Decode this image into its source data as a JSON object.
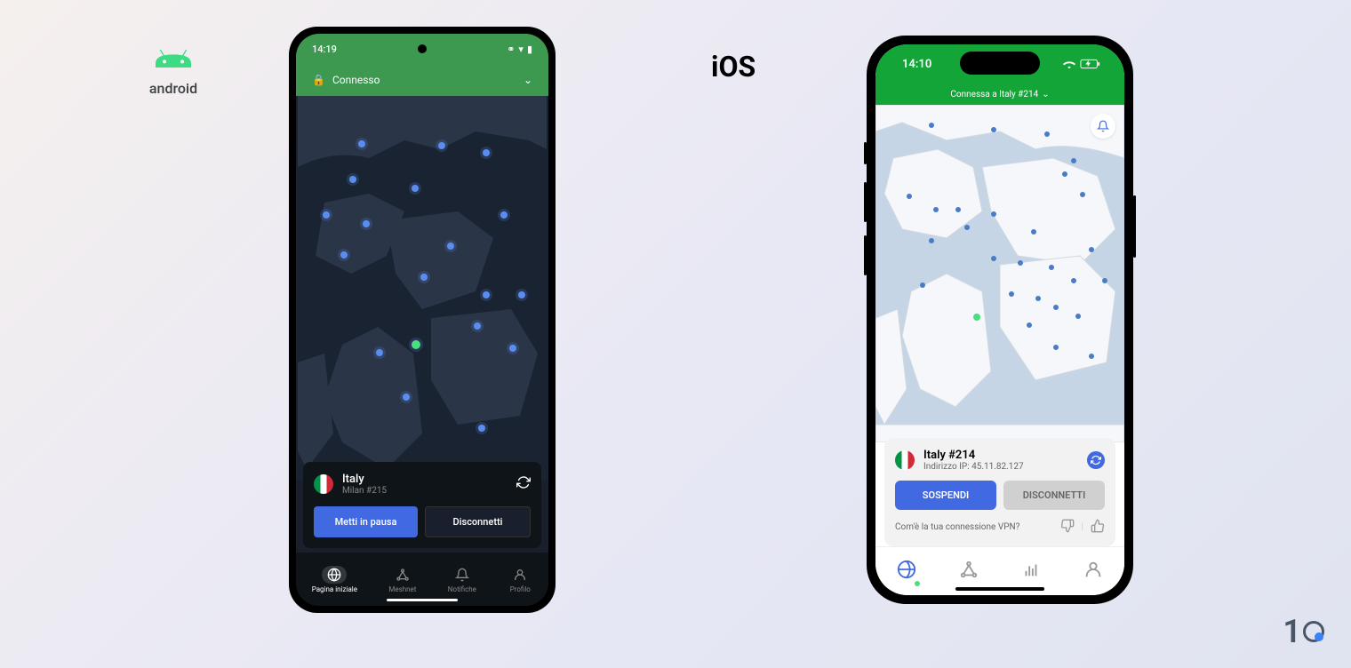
{
  "platforms": {
    "android_label": "android",
    "ios_label": "iOS"
  },
  "android": {
    "status": {
      "time": "14:19"
    },
    "connected_label": "Connesso",
    "location": {
      "country": "Italy",
      "server": "Milan #215"
    },
    "buttons": {
      "pause": "Metti in pausa",
      "disconnect": "Disconnetti"
    },
    "nav": [
      {
        "label": "Pagina iniziale",
        "icon": "globe",
        "active": true
      },
      {
        "label": "Meshnet",
        "icon": "mesh",
        "active": false
      },
      {
        "label": "Notifiche",
        "icon": "bell",
        "active": false
      },
      {
        "label": "Profilo",
        "icon": "profile",
        "active": false
      }
    ]
  },
  "ios": {
    "status": {
      "time": "14:10"
    },
    "connected_label": "Connessa a Italy #214",
    "location": {
      "server": "Italy #214",
      "ip_label": "Indirizzo IP: 45.11.82.127"
    },
    "buttons": {
      "pause": "SOSPENDI",
      "disconnect": "DISCONNETTI"
    },
    "feedback": {
      "question": "Com'è la tua connessione VPN?"
    }
  },
  "watermark": "1"
}
